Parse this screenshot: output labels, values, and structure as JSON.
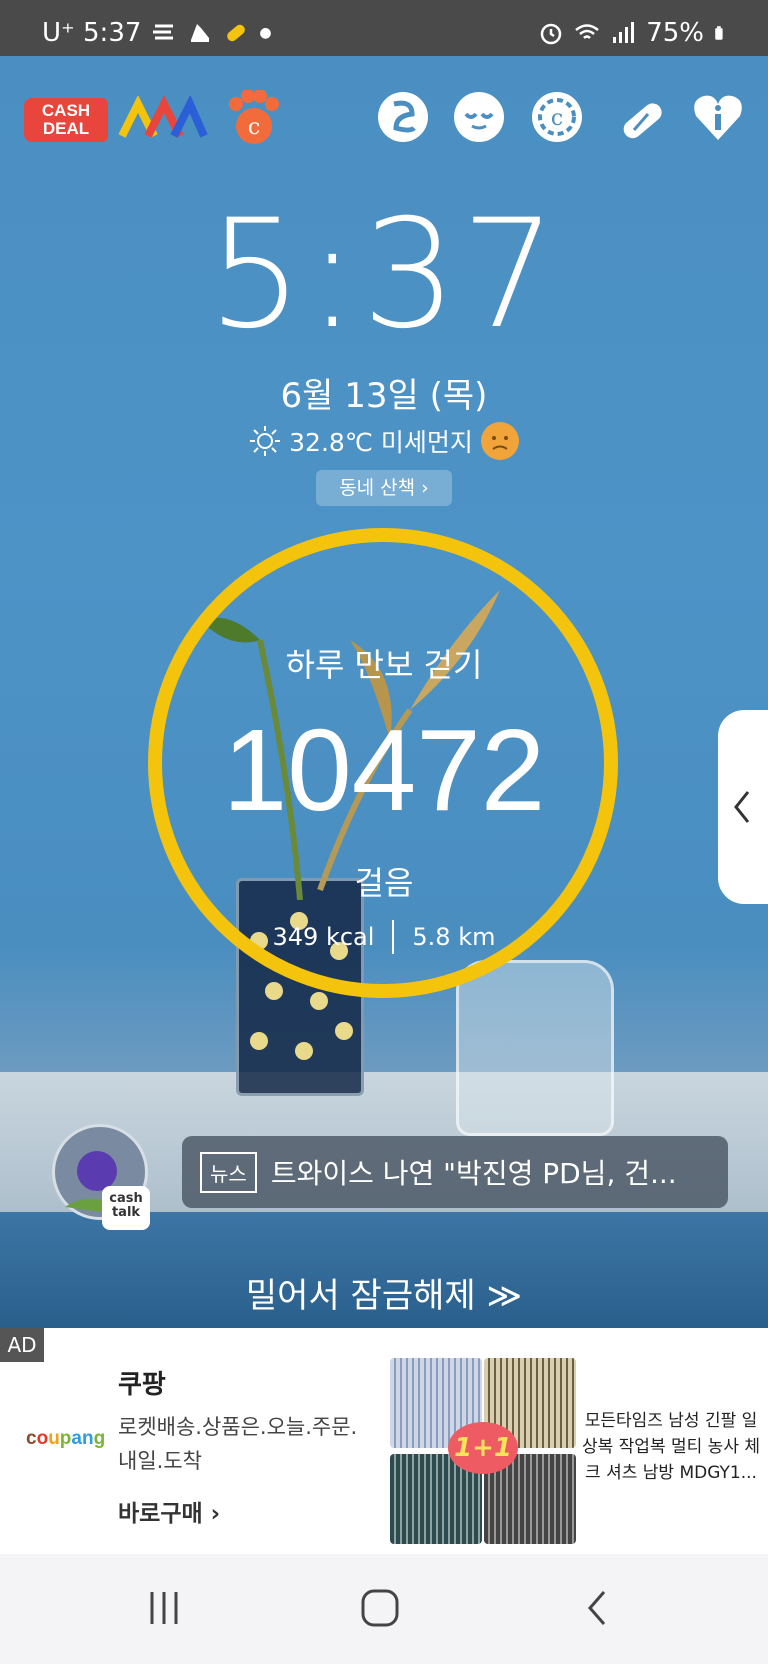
{
  "status_bar": {
    "carrier_time": "U⁺ 5:37",
    "battery": "75%"
  },
  "top_apps": {
    "cashdeal_label_1": "CASH",
    "cashdeal_label_2": "DEAL"
  },
  "lockscreen": {
    "time": "5:37",
    "date": "6월 13일 (목)",
    "weather": "32.8℃ 미세먼지",
    "walk_button": "동네 산책 ›"
  },
  "pedometer": {
    "title": "하루 만보 걷기",
    "steps": "10472",
    "unit": "걸음",
    "kcal": "349 kcal",
    "distance": "5.8 km",
    "ring_color": "#f4c40c"
  },
  "news": {
    "cashtalk_label": "cash talk",
    "tag": "뉴스",
    "headline": "트와이스 나연 \"박진영 PD님, 건..."
  },
  "unlock_text": "밀어서 잠금해제 ≫",
  "ad": {
    "tag": "AD",
    "logo": "coupang",
    "brand": "쿠팡",
    "description": "로켓배송.상품은.오늘.주문.내일.도착",
    "cta": "바로구매 ›",
    "badge": "1+1",
    "product": "모든타임즈 남성 긴팔 일상복 작업복 멀티 농사 체크 셔츠 남방 MDGY1..."
  },
  "nav": {
    "recent": "recent-apps",
    "home": "home",
    "back": "back"
  }
}
